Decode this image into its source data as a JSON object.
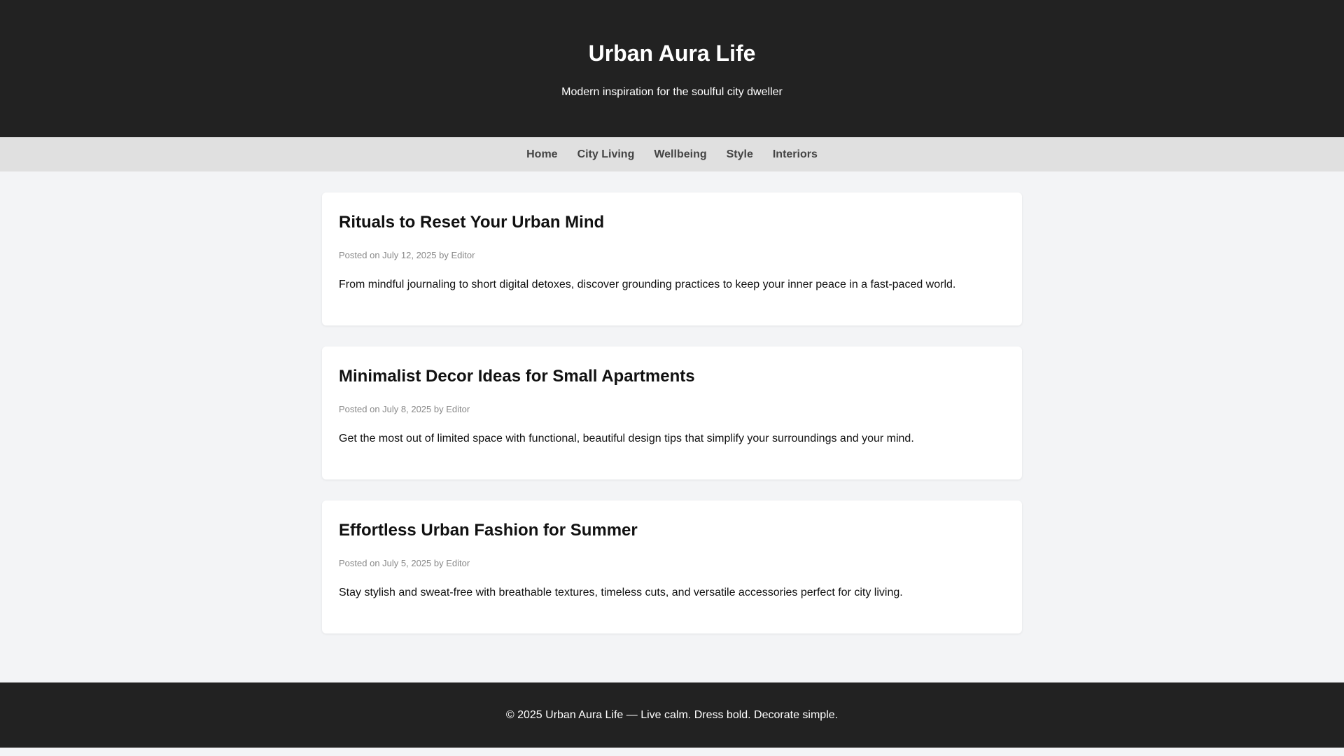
{
  "header": {
    "title": "Urban Aura Life",
    "tagline": "Modern inspiration for the soulful city dweller"
  },
  "nav": {
    "items": [
      {
        "label": "Home"
      },
      {
        "label": "City Living"
      },
      {
        "label": "Wellbeing"
      },
      {
        "label": "Style"
      },
      {
        "label": "Interiors"
      }
    ]
  },
  "posts": [
    {
      "title": "Rituals to Reset Your Urban Mind",
      "meta": "Posted on July 12, 2025 by Editor",
      "excerpt": "From mindful journaling to short digital detoxes, discover grounding practices to keep your inner peace in a fast-paced world."
    },
    {
      "title": "Minimalist Decor Ideas for Small Apartments",
      "meta": "Posted on July 8, 2025 by Editor",
      "excerpt": "Get the most out of limited space with functional, beautiful design tips that simplify your surroundings and your mind."
    },
    {
      "title": "Effortless Urban Fashion for Summer",
      "meta": "Posted on July 5, 2025 by Editor",
      "excerpt": "Stay stylish and sweat-free with breathable textures, timeless cuts, and versatile accessories perfect for city living."
    }
  ],
  "footer": {
    "text": "© 2025 Urban Aura Life — Live calm. Dress bold. Decorate simple."
  },
  "colors": {
    "header_bg": "#222222",
    "nav_bg": "#e0e0e0",
    "page_bg": "#f3f4f6",
    "card_bg": "#ffffff",
    "meta_text": "#888888"
  }
}
